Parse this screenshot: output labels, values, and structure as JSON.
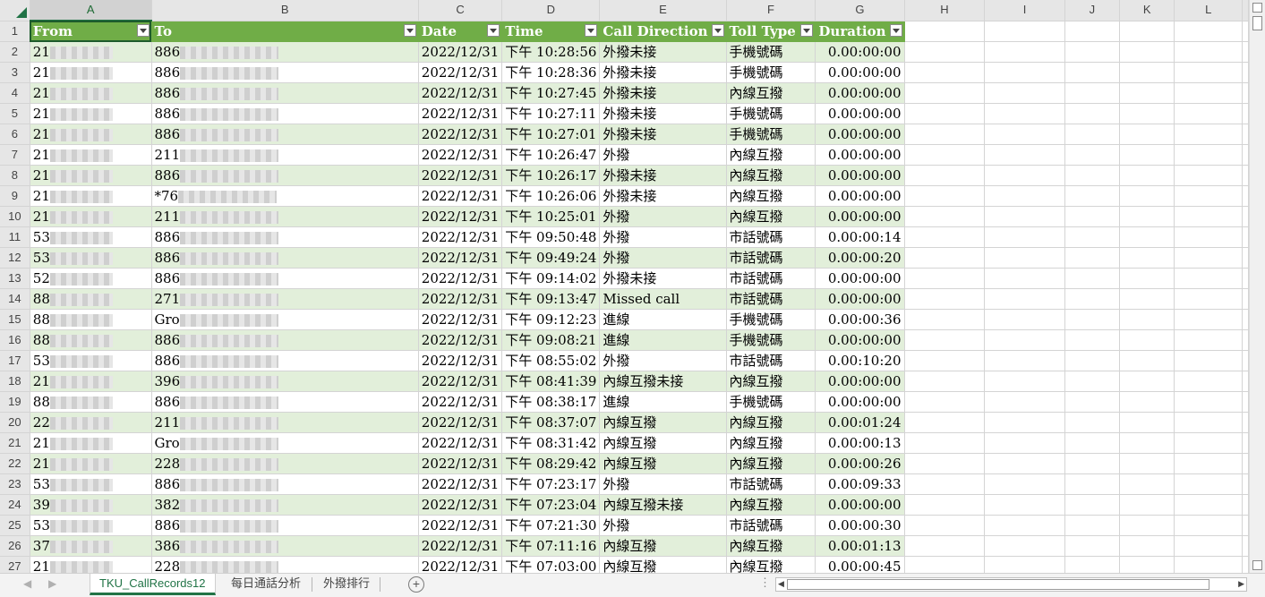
{
  "columns": [
    "A",
    "B",
    "C",
    "D",
    "E",
    "F",
    "G",
    "H",
    "I",
    "J",
    "K",
    "L"
  ],
  "selected_column": "A",
  "header_row": {
    "row_number": "1",
    "cells": [
      "From",
      "To",
      "Date",
      "Time",
      "Call Direction",
      "Toll Type",
      "Duration"
    ]
  },
  "rows": [
    {
      "n": "2",
      "from": "21",
      "to": "886",
      "date": "2022/12/31",
      "time": "下午 10:28:56",
      "dir": "外撥未接",
      "toll": "手機號碼",
      "dur": "0.00:00:00"
    },
    {
      "n": "3",
      "from": "21",
      "to": "886",
      "date": "2022/12/31",
      "time": "下午 10:28:36",
      "dir": "外撥未接",
      "toll": "手機號碼",
      "dur": "0.00:00:00"
    },
    {
      "n": "4",
      "from": "21",
      "to": "886",
      "date": "2022/12/31",
      "time": "下午 10:27:45",
      "dir": "外撥未接",
      "toll": "內線互撥",
      "dur": "0.00:00:00"
    },
    {
      "n": "5",
      "from": "21",
      "to": "886",
      "date": "2022/12/31",
      "time": "下午 10:27:11",
      "dir": "外撥未接",
      "toll": "手機號碼",
      "dur": "0.00:00:00"
    },
    {
      "n": "6",
      "from": "21",
      "to": "886",
      "date": "2022/12/31",
      "time": "下午 10:27:01",
      "dir": "外撥未接",
      "toll": "手機號碼",
      "dur": "0.00:00:00"
    },
    {
      "n": "7",
      "from": "21",
      "to": "211",
      "date": "2022/12/31",
      "time": "下午 10:26:47",
      "dir": "外撥",
      "toll": "內線互撥",
      "dur": "0.00:00:00"
    },
    {
      "n": "8",
      "from": "21",
      "to": "886",
      "date": "2022/12/31",
      "time": "下午 10:26:17",
      "dir": "外撥未接",
      "toll": "內線互撥",
      "dur": "0.00:00:00"
    },
    {
      "n": "9",
      "from": "21",
      "to": "*76",
      "date": "2022/12/31",
      "time": "下午 10:26:06",
      "dir": "外撥未接",
      "toll": "內線互撥",
      "dur": "0.00:00:00"
    },
    {
      "n": "10",
      "from": "21",
      "to": "211",
      "date": "2022/12/31",
      "time": "下午 10:25:01",
      "dir": "外撥",
      "toll": "內線互撥",
      "dur": "0.00:00:00"
    },
    {
      "n": "11",
      "from": "53",
      "to": "886",
      "date": "2022/12/31",
      "time": "下午 09:50:48",
      "dir": "外撥",
      "toll": "市話號碼",
      "dur": "0.00:00:14"
    },
    {
      "n": "12",
      "from": "53",
      "to": "886",
      "date": "2022/12/31",
      "time": "下午 09:49:24",
      "dir": "外撥",
      "toll": "市話號碼",
      "dur": "0.00:00:20"
    },
    {
      "n": "13",
      "from": "52",
      "to": "886",
      "date": "2022/12/31",
      "time": "下午 09:14:02",
      "dir": "外撥未接",
      "toll": "市話號碼",
      "dur": "0.00:00:00"
    },
    {
      "n": "14",
      "from": "88",
      "to": "271",
      "date": "2022/12/31",
      "time": "下午 09:13:47",
      "dir": "Missed call",
      "toll": "市話號碼",
      "dur": "0.00:00:00"
    },
    {
      "n": "15",
      "from": "88",
      "to": "Gro",
      "date": "2022/12/31",
      "time": "下午 09:12:23",
      "dir": "進線",
      "toll": "手機號碼",
      "dur": "0.00:00:36"
    },
    {
      "n": "16",
      "from": "88",
      "to": "886",
      "date": "2022/12/31",
      "time": "下午 09:08:21",
      "dir": "進線",
      "toll": "手機號碼",
      "dur": "0.00:00:00"
    },
    {
      "n": "17",
      "from": "53",
      "to": "886",
      "date": "2022/12/31",
      "time": "下午 08:55:02",
      "dir": "外撥",
      "toll": "市話號碼",
      "dur": "0.00:10:20"
    },
    {
      "n": "18",
      "from": "21",
      "to": "396",
      "date": "2022/12/31",
      "time": "下午 08:41:39",
      "dir": "內線互撥未接",
      "toll": "內線互撥",
      "dur": "0.00:00:00"
    },
    {
      "n": "19",
      "from": "88",
      "to": "886",
      "date": "2022/12/31",
      "time": "下午 08:38:17",
      "dir": "進線",
      "toll": "手機號碼",
      "dur": "0.00:00:00"
    },
    {
      "n": "20",
      "from": "22",
      "to": "211",
      "date": "2022/12/31",
      "time": "下午 08:37:07",
      "dir": "內線互撥",
      "toll": "內線互撥",
      "dur": "0.00:01:24"
    },
    {
      "n": "21",
      "from": "21",
      "to": "Gro",
      "date": "2022/12/31",
      "time": "下午 08:31:42",
      "dir": "內線互撥",
      "toll": "內線互撥",
      "dur": "0.00:00:13"
    },
    {
      "n": "22",
      "from": "21",
      "to": "228",
      "date": "2022/12/31",
      "time": "下午 08:29:42",
      "dir": "內線互撥",
      "toll": "內線互撥",
      "dur": "0.00:00:26"
    },
    {
      "n": "23",
      "from": "53",
      "to": "886",
      "date": "2022/12/31",
      "time": "下午 07:23:17",
      "dir": "外撥",
      "toll": "市話號碼",
      "dur": "0.00:09:33"
    },
    {
      "n": "24",
      "from": "39",
      "to": "382",
      "date": "2022/12/31",
      "time": "下午 07:23:04",
      "dir": "內線互撥未接",
      "toll": "內線互撥",
      "dur": "0.00:00:00"
    },
    {
      "n": "25",
      "from": "53",
      "to": "886",
      "date": "2022/12/31",
      "time": "下午 07:21:30",
      "dir": "外撥",
      "toll": "市話號碼",
      "dur": "0.00:00:30"
    },
    {
      "n": "26",
      "from": "37",
      "to": "386",
      "date": "2022/12/31",
      "time": "下午 07:11:16",
      "dir": "內線互撥",
      "toll": "內線互撥",
      "dur": "0.00:01:13"
    },
    {
      "n": "27",
      "from": "21",
      "to": "228",
      "date": "2022/12/31",
      "time": "下午 07:03:00",
      "dir": "內線互撥",
      "toll": "內線互撥",
      "dur": "0.00:00:45"
    }
  ],
  "sheet_tabs": [
    {
      "label": "TKU_CallRecords12",
      "active": true
    },
    {
      "label": "每日通話分析",
      "active": false
    },
    {
      "label": "外撥排行",
      "active": false
    }
  ],
  "icons": {
    "add_sheet": "plus-circle-icon",
    "filter": "filter-dropdown-icon",
    "select_all": "select-all-triangle-icon"
  },
  "colors": {
    "header_fill": "#70ad47",
    "band_fill": "#e2efda",
    "accent": "#217346"
  }
}
